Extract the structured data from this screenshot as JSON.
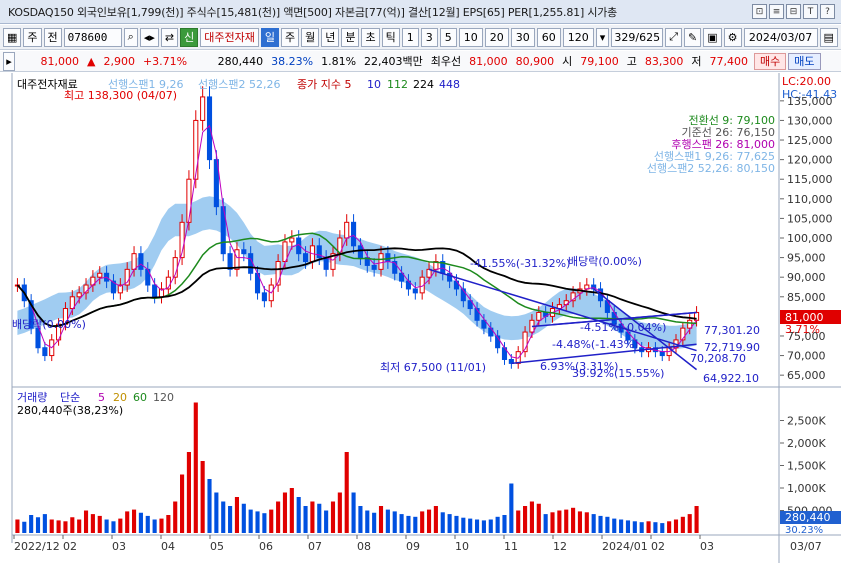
{
  "title_bar": {
    "text": "KOSDAQ150 외국인보유[1,799(천)] 주식수[15,481(천)] 액면[500] 자본금[77(억)] 결산[12월] EPS[65] PER[1,255.81] 시가총",
    "buttons": [
      "⊡",
      "≡",
      "⊟",
      "T",
      "?"
    ]
  },
  "toolbar": {
    "market": "주",
    "full": "전",
    "code": "078600",
    "new_badge": "신",
    "stock_name": "대주전자재",
    "periods": [
      "일",
      "주",
      "월",
      "년",
      "분",
      "초",
      "틱"
    ],
    "active_period": "일",
    "intervals": [
      "1",
      "3",
      "5",
      "10",
      "20",
      "30",
      "60",
      "120"
    ],
    "page_count": "329/625",
    "date": "2024/03/07"
  },
  "quote": {
    "price": "81,000",
    "arrow": "▲",
    "change": "2,900",
    "change_pct": "+3.71%",
    "volume": "280,440",
    "turnover_pct": "38.23%",
    "ratio": "1.81%",
    "amount": "22,403백만",
    "best_bid_label": "최우선",
    "best_bid": "81,000",
    "best_ask": "80,900",
    "open_label": "시",
    "open": "79,100",
    "high_label": "고",
    "high": "83,300",
    "low_label": "저",
    "low": "77,400",
    "buy_label": "매수",
    "sell_label": "매도"
  },
  "chart_data": {
    "type": "candlestick",
    "legend": {
      "stock": "대주전자재료",
      "span1": "선행스팬1 9,26",
      "span2": "선행스팬2 52,26",
      "ma_label": "종가 지수 5",
      "ma_periods": [
        "10",
        "112",
        "224",
        "448"
      ]
    },
    "lc": "LC:20.00",
    "hc": "HC:-41.43",
    "ichimoku_labels": [
      "전환선 9: 79,100",
      "기준선 26: 76,150",
      "후행스팬 26: 81,000",
      "선행스팬1 9,26: 77,625",
      "선행스팬2 52,26: 80,150"
    ],
    "price_ticks": [
      135000,
      130000,
      125000,
      120000,
      115000,
      110000,
      105000,
      100000,
      95000,
      90000,
      85000,
      80000,
      75000,
      70000,
      65000
    ],
    "price_ticks_text": [
      "135,000",
      "130,000",
      "125,000",
      "120,000",
      "115,000",
      "110,000",
      "105,000",
      "100,000",
      "95,000",
      "90,000",
      "85,000",
      "80,000",
      "75,000",
      "70,000",
      "65,000"
    ],
    "current_price": "81,000",
    "current_pct": "3.71%",
    "annotations": {
      "high": "최고 138,300 (04/07)",
      "low": "최저 67,500 (11/01)",
      "trend1": "-41.55%(-31.32%)",
      "trend1_tail": "배당락(0.00%)",
      "trend2": "-4.51%(-0.04%)",
      "trend3": "-4.48%(-1.43%)",
      "trend4": "6.93%(3.31%)",
      "trend5": "39.92%(15.55%)",
      "left_note": "배당락(0.00%)",
      "p1": "77,301.20",
      "p2": "72,719.90",
      "p3": "70,208.70",
      "p4": "64,922.10"
    },
    "volume_legend": {
      "label": "거래량",
      "kind": "단순",
      "ma_periods": [
        "5",
        "20",
        "60",
        "120"
      ],
      "value": "280,440주(38,23%)"
    },
    "volume_ticks": [
      2500000,
      2000000,
      1500000,
      1000000,
      500000
    ],
    "volume_ticks_text": [
      "2,500K",
      "2,000K",
      "1,500K",
      "1,000K",
      "500,000"
    ],
    "volume_current": "280,440",
    "volume_pct": "30.23%",
    "x_labels": [
      "2022/12",
      "02",
      "03",
      "04",
      "05",
      "06",
      "07",
      "08",
      "09",
      "10",
      "11",
      "12",
      "2024/01",
      "02",
      "03"
    ],
    "x_label_right": "03/07",
    "close_series": [
      88000,
      84000,
      77000,
      72000,
      70000,
      74000,
      78000,
      82000,
      85000,
      86000,
      88000,
      90000,
      91000,
      89000,
      86000,
      88000,
      92000,
      96000,
      92000,
      88000,
      85000,
      87000,
      90000,
      95000,
      104000,
      115000,
      130000,
      136000,
      120000,
      108000,
      96000,
      92000,
      97000,
      96000,
      91000,
      86000,
      84000,
      88000,
      94000,
      99000,
      100000,
      96000,
      94000,
      98000,
      95000,
      92000,
      96000,
      100000,
      104000,
      98000,
      95000,
      93000,
      92000,
      96000,
      94000,
      91000,
      89000,
      87000,
      86000,
      90000,
      92000,
      94000,
      91000,
      89000,
      87000,
      84000,
      82000,
      79000,
      77000,
      75000,
      72000,
      69000,
      68000,
      71000,
      76000,
      79000,
      81000,
      80000,
      82000,
      83000,
      84000,
      86000,
      87000,
      88000,
      87000,
      84000,
      81000,
      78000,
      76000,
      74000,
      72000,
      71000,
      72000,
      71000,
      70000,
      72000,
      74000,
      77000,
      79000,
      81000
    ],
    "volume_series": [
      300000,
      250000,
      400000,
      350000,
      420000,
      300000,
      280000,
      260000,
      350000,
      300000,
      500000,
      420000,
      380000,
      300000,
      260000,
      320000,
      480000,
      520000,
      450000,
      380000,
      300000,
      320000,
      400000,
      700000,
      1300000,
      1800000,
      2900000,
      1600000,
      1200000,
      900000,
      700000,
      600000,
      800000,
      650000,
      520000,
      480000,
      440000,
      520000,
      700000,
      900000,
      1000000,
      800000,
      600000,
      700000,
      650000,
      500000,
      700000,
      900000,
      1800000,
      900000,
      600000,
      500000,
      450000,
      600000,
      520000,
      480000,
      420000,
      380000,
      360000,
      480000,
      520000,
      600000,
      460000,
      420000,
      380000,
      340000,
      320000,
      300000,
      280000,
      300000,
      360000,
      400000,
      1100000,
      500000,
      600000,
      700000,
      650000,
      420000,
      460000,
      500000,
      520000,
      560000,
      480000,
      460000,
      420000,
      380000,
      360000,
      320000,
      300000,
      280000,
      260000,
      240000,
      260000,
      240000,
      220000,
      260000,
      300000,
      360000,
      420000,
      600000
    ],
    "colors": {
      "up": "#e00000",
      "down": "#0050e0",
      "cloud": "#8fc3ef",
      "ma_black": "#000000",
      "ma_green": "#1d8a1d",
      "trend": "#2020c8"
    }
  }
}
